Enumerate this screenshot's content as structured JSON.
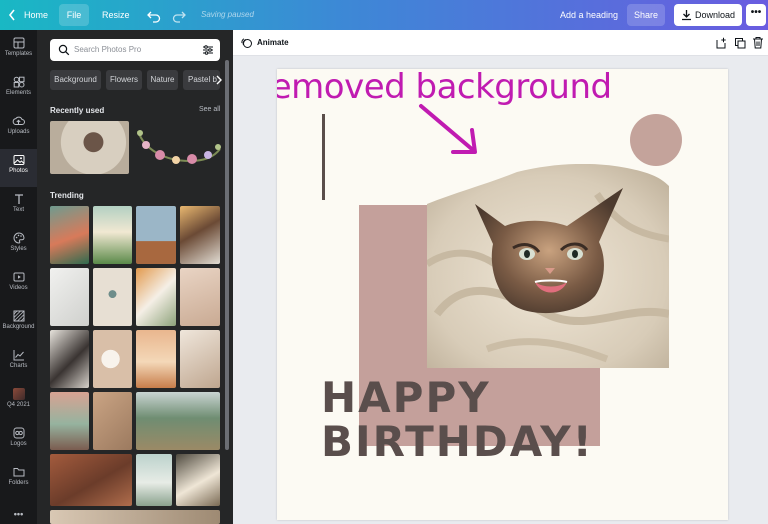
{
  "topbar": {
    "home": "Home",
    "file": "File",
    "resize": "Resize",
    "saving": "Saving paused",
    "add_heading": "Add a heading",
    "share": "Share",
    "download": "Download",
    "more": "•••"
  },
  "sidebar": {
    "items": [
      {
        "label": "Templates",
        "icon": "templates-icon"
      },
      {
        "label": "Elements",
        "icon": "elements-icon"
      },
      {
        "label": "Uploads",
        "icon": "uploads-icon"
      },
      {
        "label": "Photos",
        "icon": "photos-icon",
        "active": true
      },
      {
        "label": "Text",
        "icon": "text-icon"
      },
      {
        "label": "Styles",
        "icon": "styles-icon"
      },
      {
        "label": "Videos",
        "icon": "videos-icon"
      },
      {
        "label": "Background",
        "icon": "background-icon"
      },
      {
        "label": "Charts",
        "icon": "charts-icon"
      },
      {
        "label": "Q4 2021",
        "icon": "folder-thumbnail"
      },
      {
        "label": "Logos",
        "icon": "logos-icon"
      },
      {
        "label": "Folders",
        "icon": "folders-icon"
      }
    ],
    "more": "•••"
  },
  "photos_panel": {
    "search_placeholder": "Search Photos Pro",
    "chips": [
      "Background",
      "Flowers",
      "Nature",
      "Pastel b"
    ],
    "recently_used_title": "Recently used",
    "see_all": "See all",
    "trending_title": "Trending"
  },
  "editor": {
    "animate": "Animate",
    "annotation": "removed background",
    "heading_line1": "HAPPY",
    "heading_line2": "BIRTHDAY!"
  },
  "colors": {
    "accent_pink": "#c01bb1",
    "rose": "#c4a09b",
    "heading_text": "#5a4e4c",
    "page_bg": "#fcfaf3"
  }
}
